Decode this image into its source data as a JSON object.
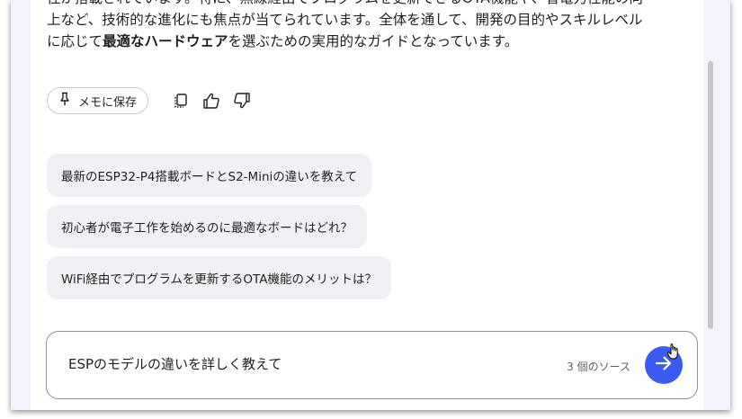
{
  "response": {
    "line1": "性が搭載されています。特に、無線経由でプログラムを更新できるOTA機能や、省電力性能の向",
    "line2": "上など、技術的な進化にも焦点が当てられています。全体を通して、開発の目的やスキルレベル",
    "line3_pre": "に応じて",
    "line3_bold1": "最適なハードウェア",
    "line3_post": "を選ぶための実用的なガイドとなっています。"
  },
  "actions": {
    "save_note_label": "メモに保存",
    "icons": [
      "pin-icon",
      "copy-icon",
      "thumbs-up-icon",
      "thumbs-down-icon"
    ]
  },
  "suggestions": [
    "最新のESP32-P4搭載ボードとS2-Miniの違いを教えて",
    "初心者が電子工作を始めるのに最適なボードはどれ？",
    "WiFi経由でプログラムを更新するOTA機能のメリットは？"
  ],
  "composer": {
    "input_value": "ESPのモデルの違いを詳しく教えて",
    "source_count": "3 個のソース",
    "send_icon": "arrow-right-icon"
  },
  "colors": {
    "accent": "#3b5cf0",
    "chip_bg": "#f0f1f4",
    "frame_bg": "#f3f4fb"
  }
}
